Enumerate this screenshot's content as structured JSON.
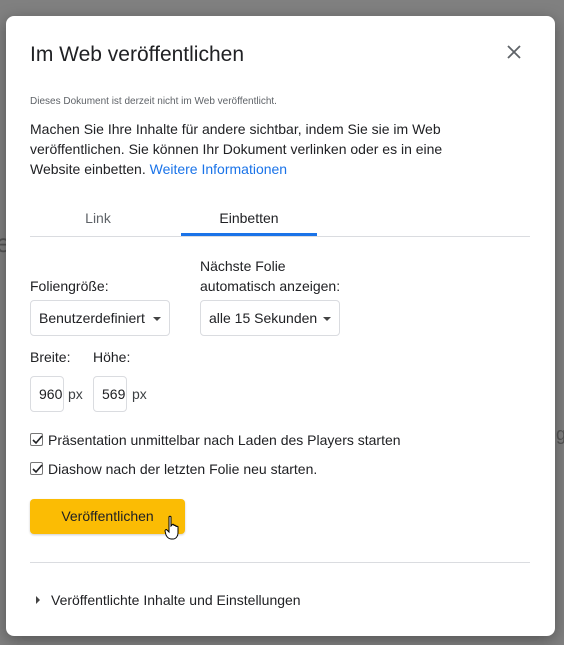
{
  "dialog": {
    "title": "Im Web veröffentlichen",
    "close_icon": "close-icon",
    "status": "Dieses Dokument ist derzeit nicht im Web veröffentlicht.",
    "description": "Machen Sie Ihre Inhalte für andere sichtbar, indem Sie sie im Web veröffentlichen. Sie können Ihr Dokument verlinken oder es in eine Website einbetten.",
    "learn_more": "Weitere Informationen"
  },
  "tabs": [
    {
      "label": "Link",
      "active": false
    },
    {
      "label": "Einbetten",
      "active": true
    }
  ],
  "embed": {
    "slide_size_label": "Foliengröße:",
    "slide_size_value": "Benutzerdefiniert",
    "next_slide_label_1": "Nächste Folie",
    "next_slide_label_2": "automatisch anzeigen:",
    "next_slide_value": "alle 15 Sekunden",
    "width_label": "Breite:",
    "height_label": "Höhe:",
    "width_value": "960",
    "height_value": "569",
    "unit": "px",
    "options": [
      {
        "label": "Präsentation unmittelbar nach Laden des Players starten",
        "checked": true
      },
      {
        "label": "Diashow nach der letzten Folie neu starten.",
        "checked": true
      }
    ],
    "publish_label": "Veröffentlichen"
  },
  "footer": {
    "expander_label": "Veröffentlichte Inhalte und Einstellungen"
  },
  "colors": {
    "accent": "#1a73e8",
    "publish": "#fbbc04",
    "backdrop": "#808080"
  }
}
